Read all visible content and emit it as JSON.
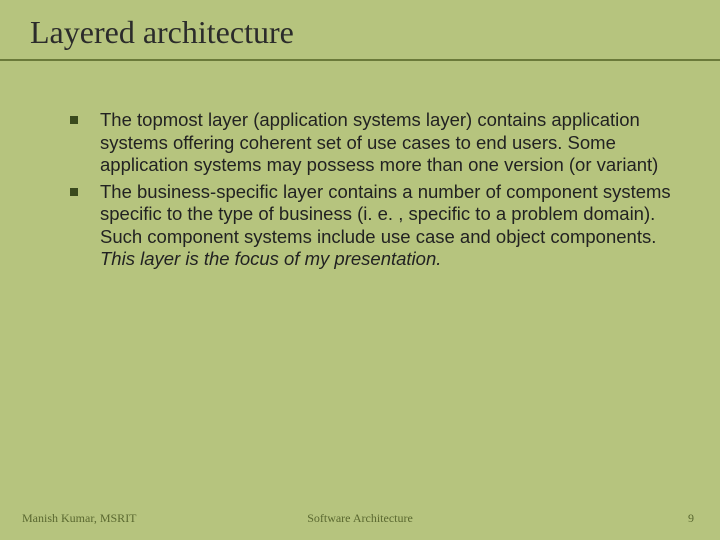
{
  "title": "Layered architecture",
  "bullets": [
    {
      "text_plain": "The topmost layer (application systems layer) contains application systems offering coherent set of use cases to end users. Some application systems may possess more than one version (or variant)"
    },
    {
      "text_plain": "The business-specific layer contains a number of component systems specific to the type of business (i. e. , specific to a problem domain). Such component systems include use case and object components. ",
      "italic_tail": "This layer is the focus of my presentation."
    }
  ],
  "footer": {
    "left": "Manish Kumar, MSRIT",
    "center": "Software Architecture",
    "right": "9"
  }
}
